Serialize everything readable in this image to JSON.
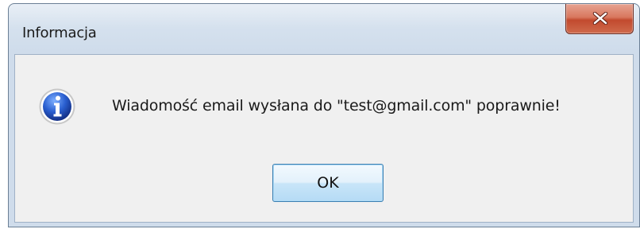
{
  "dialog": {
    "title": "Informacja",
    "message": "Wiadomość email wysłana do \"test@gmail.com\" poprawnie!",
    "ok_label": "OK",
    "icon": "info-icon"
  },
  "colors": {
    "close_button": "#c24a2e",
    "ok_button_border": "#3c7fb1",
    "client_background": "#f0f0f0"
  }
}
